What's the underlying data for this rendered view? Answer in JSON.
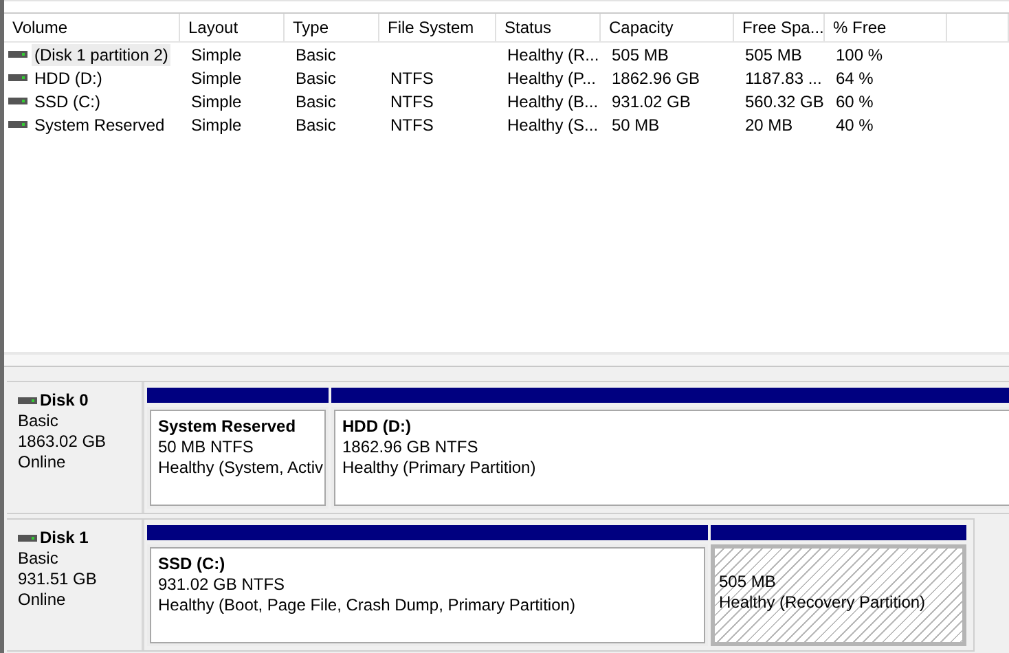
{
  "volume_list": {
    "columns": [
      "Volume",
      "Layout",
      "Type",
      "File System",
      "Status",
      "Capacity",
      "Free Spa...",
      "% Free"
    ],
    "rows": [
      {
        "cells": [
          "(Disk 1 partition 2)",
          "Simple",
          "Basic",
          "",
          "Healthy (R...",
          "505 MB",
          "505 MB",
          "100 %"
        ],
        "selected": true
      },
      {
        "cells": [
          "HDD (D:)",
          "Simple",
          "Basic",
          "NTFS",
          "Healthy (P...",
          "1862.96 GB",
          "1187.83 ...",
          "64 %"
        ],
        "selected": false
      },
      {
        "cells": [
          "SSD (C:)",
          "Simple",
          "Basic",
          "NTFS",
          "Healthy (B...",
          "931.02 GB",
          "560.32 GB",
          "60 %"
        ],
        "selected": false
      },
      {
        "cells": [
          "System Reserved",
          "Simple",
          "Basic",
          "NTFS",
          "Healthy (S...",
          "50 MB",
          "20 MB",
          "40 %"
        ],
        "selected": false
      }
    ]
  },
  "disks": [
    {
      "name": "Disk 0",
      "type": "Basic",
      "size": "1863.02 GB",
      "state": "Online",
      "partitions": [
        {
          "name": "System Reserved",
          "size": "50 MB NTFS",
          "status": "Healthy (System, Activ",
          "selected": false
        },
        {
          "name": "HDD  (D:)",
          "size": "1862.96 GB NTFS",
          "status": "Healthy (Primary Partition)",
          "selected": false
        }
      ]
    },
    {
      "name": "Disk 1",
      "type": "Basic",
      "size": "931.51 GB",
      "state": "Online",
      "partitions": [
        {
          "name": "SSD  (C:)",
          "size": "931.02 GB NTFS",
          "status": "Healthy (Boot, Page File, Crash Dump, Primary Partition)",
          "selected": false
        },
        {
          "size": "505 MB",
          "status": "Healthy (Recovery Partition)",
          "selected": true
        }
      ]
    }
  ]
}
